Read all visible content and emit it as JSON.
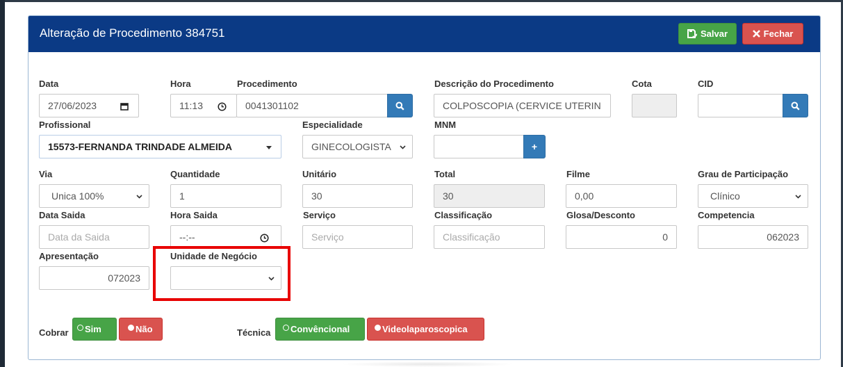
{
  "modal": {
    "title": "Alteração de Procedimento 384751",
    "save_label": "Salvar",
    "close_label": "Fechar"
  },
  "row1": {
    "data_label": "Data",
    "data_value": "27/06/2023",
    "hora_label": "Hora",
    "hora_value": "11:13",
    "procedimento_label": "Procedimento",
    "procedimento_value": "0041301102",
    "descricao_label": "Descrição do Procedimento",
    "descricao_value": "COLPOSCOPIA (CERVICE UTERIN",
    "cota_label": "Cota",
    "cota_value": "",
    "cid_label": "CID",
    "cid_value": ""
  },
  "row2": {
    "profissional_label": "Profissional",
    "profissional_value": "15573-FERNANDA TRINDADE ALMEIDA",
    "especialidade_label": "Especialidade",
    "especialidade_value": "GINECOLOGISTA",
    "mnm_label": "MNM",
    "mnm_value": "",
    "mnm_add": "+"
  },
  "row3": {
    "via_label": "Via",
    "via_value": "Unica 100%",
    "quantidade_label": "Quantidade",
    "quantidade_value": "1",
    "unitario_label": "Unitário",
    "unitario_value": "30",
    "total_label": "Total",
    "total_value": "30",
    "filme_label": "Filme",
    "filme_value": "0,00",
    "grau_label": "Grau de Participação",
    "grau_value": "Clínico"
  },
  "row4": {
    "data_saida_label": "Data Saida",
    "data_saida_placeholder": "Data da Saida",
    "hora_saida_label": "Hora Saida",
    "hora_saida_value": "--:--",
    "servico_label": "Serviço",
    "servico_placeholder": "Serviço",
    "classificacao_label": "Classificação",
    "classificacao_placeholder": "Classificação",
    "glosa_label": "Glosa/Desconto",
    "glosa_value": "0",
    "competencia_label": "Competencia",
    "competencia_value": "062023"
  },
  "row5": {
    "apresentacao_label": "Apresentação",
    "apresentacao_value": "072023",
    "unidade_label": "Unidade de Negócio",
    "unidade_value": ""
  },
  "cobrar": {
    "label": "Cobrar",
    "sim": "Sim",
    "nao": "Não"
  },
  "tecnica": {
    "label": "Técnica",
    "convencional": "Convêncional",
    "video": "Videolaparoscopica"
  },
  "colors": {
    "header": "#0b3a85",
    "success": "#47a447",
    "danger": "#d9534f",
    "primary": "#337ab7",
    "highlight": "#e80000"
  },
  "icons": [
    "save-icon",
    "close-x-icon",
    "calendar-icon",
    "clock-icon",
    "search-icon",
    "caret-down-icon",
    "plus-icon",
    "radio-icon"
  ]
}
